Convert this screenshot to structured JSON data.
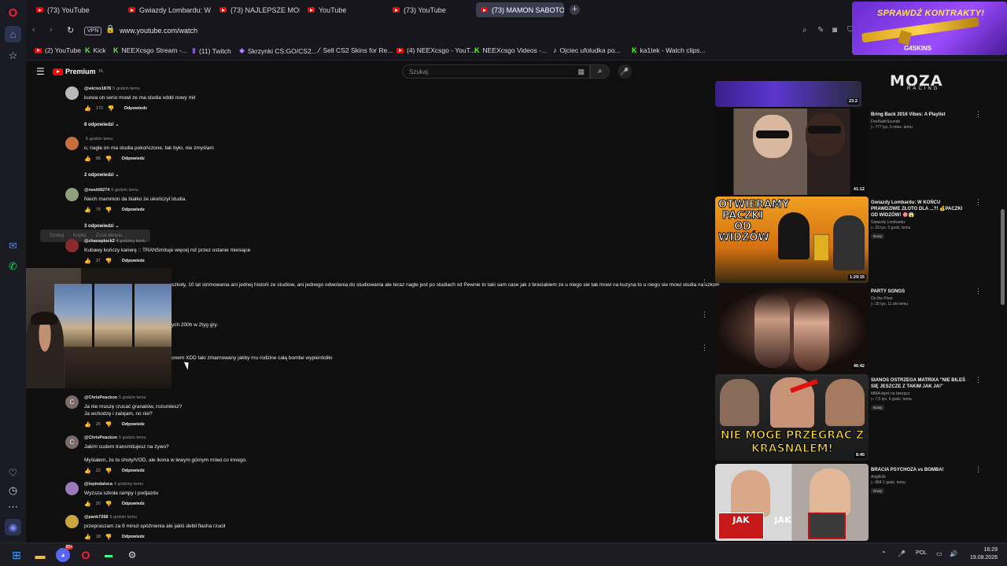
{
  "browser": {
    "tabs": [
      {
        "label": "(73) YouTube",
        "active": false
      },
      {
        "label": "Gwiazdy Lombardu: W KO",
        "active": false
      },
      {
        "label": "(73) NAJLEPSZE MOMENT",
        "active": false
      },
      {
        "label": "YouTube",
        "active": false
      },
      {
        "label": "(73) YouTube",
        "active": false
      },
      {
        "label": "(73) MAMON SABOTOWA",
        "active": true
      }
    ],
    "new_tab": "+",
    "vpn_label": "VPN",
    "url": "www.youtube.com/watch",
    "bookmarks": [
      {
        "label": "(2) YouTube",
        "icon": "youtube-icon"
      },
      {
        "label": "Kick",
        "icon": "kick-icon"
      },
      {
        "label": "NEEXcsgo Stream -...",
        "icon": "kick-icon"
      },
      {
        "label": "(11) Twitch",
        "icon": "twitch-icon"
      },
      {
        "label": "Skrzynki CS:GO/CS2...",
        "icon": "case-icon"
      },
      {
        "label": "Sell CS2 Skins for Re...",
        "icon": "skins-icon"
      },
      {
        "label": "(4) NEEXcsgo - YouT...",
        "icon": "youtube-icon"
      },
      {
        "label": "NEEXcsgo Videos -...",
        "icon": "kick-icon"
      },
      {
        "label": "Ojciec ufoludka po...",
        "icon": "tiktok-icon"
      },
      {
        "label": "ka1tek - Watch clips...",
        "icon": "kick-icon"
      }
    ]
  },
  "ad_banner": {
    "title": "SPRAWDŹ KONTRAKTY!",
    "brand": "G4SKINS"
  },
  "youtube": {
    "logo": "Premium",
    "logo_region": "PL",
    "search_placeholder": "Szukaj",
    "tooltip": [
      "Szukaj",
      "Kopiuj",
      "Zrzut ekranu"
    ],
    "comments": [
      {
        "author": "@wicioz1878",
        "time": "5 godzin temu",
        "text": "kurwa on serio mowi ze ma studia xddd nowy mit",
        "likes": "172",
        "reply": "Odpowiedz",
        "replies": "8 odpowiedzi",
        "avatar": "#b9b9b9"
      },
      {
        "author": "",
        "time": "5 godzin temu",
        "text": "o, nagle on ma studia pokończone, tak było, nie zmyślam",
        "likes": "88",
        "reply": "Odpowiedz",
        "replies": "2 odpowiedzi",
        "avatar": "#c76f3c"
      },
      {
        "author": "@nestit9274",
        "time": "5 godzin temu",
        "text": "Niech mammon da białko że ukończył studia.",
        "likes": "75",
        "reply": "Odpowiedz",
        "replies": "3 odpowiedzi",
        "avatar": "#8ca07a"
      },
      {
        "author": "@chaosplock2",
        "time": "4 godziny temu",
        "text": "Kubawy kończy karierę :: TRANSmituje więcej niż przez ostanie miesiące",
        "likes": "37",
        "reply": "Odpowiedz",
        "replies": "",
        "avatar": "#8a2b2b"
      }
    ],
    "partial_lines": [
      "szkoły, 10 lat strimowania ani jednej historii ze studiow, ani jednego odwolania do studiowania ale teraz nagle jest po studiach xd Pewnie to taki sam case jak z braciakiem ze u niego sie tak mowi na kuzyna to u niego sie mowi studia na szkole",
      "ych 200h w 2tyg gry.",
      "onem XDD taki zmarnowany jakby mu rodzine całą bombe wypierdoliło"
    ],
    "comments_lower": [
      {
        "author": "@ChrisPeackon",
        "time": "5 godzin temu",
        "lines": [
          "Ja nie muszę rzucać granatów, rozumiesz?",
          "Ja wchodzę i zabijam, no nie?"
        ],
        "likes": "26",
        "reply": "Odpowiedz",
        "avatar": "#7a6a6a",
        "initial": "C"
      },
      {
        "author": "@ChrisPeackon",
        "time": "5 godzin temu",
        "lines": [
          "Jakim cudem transmitujesz na żywo?",
          "",
          "Myślałem, że to shoty/VOD, ale ikona w lewym górnym mówi co innego."
        ],
        "likes": "22",
        "reply": "Odpowiedz",
        "avatar": "#7a6a6a",
        "initial": "C"
      },
      {
        "author": "@lopindaloca",
        "time": "4 godziny temu",
        "lines": [
          "Wyższa szkoła rampy i podjazdu"
        ],
        "likes": "20",
        "reply": "Odpowiedz",
        "avatar": "#9a7ab8",
        "initial": ""
      },
      {
        "author": "@pank7268",
        "time": "5 godzin temu",
        "lines": [
          "przepraszam za 9 minut spóźnienia ale jakiś debil flasha rzucił"
        ],
        "likes": "18",
        "reply": "Odpowiedz",
        "avatar": "#c9a640",
        "initial": ""
      }
    ],
    "recommendations": [
      {
        "title": "Bring Back 2016 Vibes: A Playlist",
        "channel": "FeelSafeSounds",
        "meta": "▷ 777 tys.  6 mies. temu",
        "badge": "",
        "duration": "41:12"
      },
      {
        "title": "Gwiazdy Lombardu: W KOŃCU PRAWDZIWE ZŁOTO DLA ...?! 💰PACZKI OD WIDZÓW! 🎯😱",
        "channel": "Gwiazdy Lombardu",
        "meta": "▷ 33 tys.  2 godz. temu",
        "badge": "Nowy",
        "duration": "1:29:15",
        "thumb_text": "OTWIERAMY PACZKI OD WIDZÓW"
      },
      {
        "title": "PARTY SONGS",
        "channel": "On the Floor",
        "meta": "▷ 20 tys.  11 dni temu",
        "badge": "",
        "duration": "46:42"
      },
      {
        "title": "SIANOS OSTRZEGA MATRIXA \"NIE BILEŚ SIĘ JESZCZE Z TAKIM JAK JA!\"",
        "channel": "MMA-biješ na brezqcz",
        "meta": "▷ 7,5 tys.  6 godz. temu",
        "badge": "Nowy",
        "duration": "8:45",
        "thumb_text": "NIE MOGĘ PRZEGRAĆ Z KRASNALEM!"
      },
      {
        "title": "BRACIA PSYCHOZA vs BOMBA!",
        "channel": "Angilk2k",
        "meta": "▷ 964  1 godz. temu",
        "badge": "Nowy",
        "duration": "",
        "thumb_text": "JAK"
      }
    ],
    "top_thumb_duration": "23:2",
    "moza_ad": {
      "line1": "MOZA",
      "line2": "RACING"
    }
  },
  "taskbar": {
    "language": "POL",
    "time": "16:29",
    "date": "19.08.2026",
    "discord_badge": "99+"
  }
}
